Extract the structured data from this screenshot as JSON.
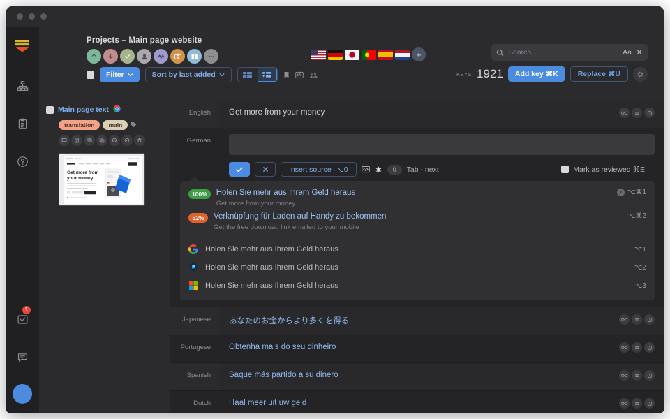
{
  "window": {
    "traffic_lights": 3
  },
  "rail": {
    "items": [
      {
        "name": "logo",
        "icon": "stacked-bars-logo"
      },
      {
        "name": "projects",
        "icon": "sitemap-icon"
      },
      {
        "name": "tasks",
        "icon": "clipboard-icon"
      },
      {
        "name": "help",
        "icon": "question-circle-icon"
      }
    ],
    "bottom": [
      {
        "name": "inbox",
        "icon": "inbox-check-icon",
        "badge": "1"
      },
      {
        "name": "chat",
        "icon": "comment-icon"
      },
      {
        "name": "avatar",
        "icon": "user-avatar"
      }
    ]
  },
  "header": {
    "project_title": "Projects – Main page website",
    "contributors": [
      {
        "icon": "arrow-up-icon",
        "color": "#7fb79b"
      },
      {
        "icon": "arrow-down-icon",
        "color": "#c08d8d"
      },
      {
        "icon": "check-icon",
        "color": "#a7b48d"
      },
      {
        "icon": "person-icon",
        "color": "#a9a9ad"
      },
      {
        "icon": "activity-icon",
        "color": "#9e9acb"
      },
      {
        "icon": "camera-icon",
        "color": "#d3924a"
      },
      {
        "icon": "book-icon",
        "color": "#8fbcd6"
      },
      {
        "icon": "ellipsis-icon",
        "color": "#8d8d92"
      }
    ],
    "flags": [
      {
        "name": "flag-usa",
        "label": "English"
      },
      {
        "name": "flag-germany",
        "label": "German"
      },
      {
        "name": "flag-japan",
        "label": "Japanese"
      },
      {
        "name": "flag-portugal",
        "label": "Portugese"
      },
      {
        "name": "flag-spain",
        "label": "Spanish"
      },
      {
        "name": "flag-netherlands",
        "label": "Dutch"
      }
    ],
    "add_language_label": "+",
    "search": {
      "placeholder": "Search...",
      "value": "",
      "aa_label": "Aa",
      "close_label": "✕"
    },
    "keys_label": "KEYS",
    "keys_count": "1921",
    "add_key_label": "Add key ⌘K",
    "replace_label": "Replace ⌘U",
    "settings_icon": "cpu-chip-icon"
  },
  "toolbar": {
    "select_all_checked": true,
    "filter_label": "Filter",
    "sort_label": "Sort by last added",
    "view_grid_icon": "grid-view-icon",
    "view_list_icon": "list-view-icon",
    "bookmark_icon": "bookmark-icon",
    "code_icon": "code-tag-icon",
    "ab_icon": "ab-compare-icon"
  },
  "key_card": {
    "name": "Main page text",
    "platform_icon": "chrome-icon",
    "tags": [
      {
        "label": "translation",
        "style": "translation"
      },
      {
        "label": "main",
        "style": "main"
      }
    ],
    "tag_more_icon": "tag-icon",
    "actions": [
      {
        "icon": "comment-icon"
      },
      {
        "icon": "description-icon"
      },
      {
        "icon": "screenshot-icon"
      },
      {
        "icon": "copy-icon"
      },
      {
        "icon": "google-translate-icon"
      },
      {
        "icon": "hidden-icon"
      },
      {
        "icon": "trash-icon"
      }
    ],
    "screenshot": {
      "headline_line1": "Get more from",
      "headline_line2": "your money",
      "alt": "landing page screenshot"
    }
  },
  "editor": {
    "source_row": {
      "language": "English",
      "value": "Get more from your money",
      "actions": [
        {
          "icon": "glasses-icon"
        },
        {
          "icon": "translate-icon"
        },
        {
          "icon": "history-icon"
        }
      ]
    },
    "active_row": {
      "language": "German",
      "input_value": "",
      "confirm_icon": "check-icon",
      "cancel_icon": "close-icon",
      "insert_source_label": "Insert source",
      "insert_source_shortcut": "⌥0",
      "code_icon": "code-tag-icon",
      "bug_icon": "bug-icon",
      "char_count": "0",
      "tab_hint": "Tab - next",
      "mark_reviewed_label": "Mark as reviewed ⌘E",
      "mark_reviewed_checked": true
    },
    "suggestions": {
      "memory": [
        {
          "score": "100%",
          "score_style": "green",
          "text": "Holen Sie mehr aus Ihrem Geld heraus",
          "source": "Get more from your money",
          "shortcut": "⌥⌘1",
          "has_remove": true
        },
        {
          "score": "52%",
          "score_style": "orange",
          "text": "Verknüpfung für Laden auf Handy zu bekommen",
          "source": "Get the free download link emailed to your mobile",
          "shortcut": "⌥⌘2",
          "has_remove": false
        }
      ],
      "engines": [
        {
          "engine": "google-translate-icon",
          "text": "Holen Sie mehr aus Ihrem Geld heraus",
          "shortcut": "⌥1"
        },
        {
          "engine": "deepl-icon",
          "text": "Holen Sie mehr aus Ihrem Geld heraus",
          "shortcut": "⌥2"
        },
        {
          "engine": "microsoft-translator-icon",
          "text": "Holen Sie mehr aus Ihrem Geld heraus",
          "shortcut": "⌥3"
        }
      ]
    },
    "other_rows": [
      {
        "language": "Japanese",
        "value": "あなたのお金からより多くを得る",
        "actions": [
          {
            "icon": "glasses-icon"
          },
          {
            "icon": "translate-icon"
          },
          {
            "icon": "history-icon"
          }
        ]
      },
      {
        "language": "Portugese",
        "value": "Obtenha mais do seu dinheiro",
        "actions": [
          {
            "icon": "glasses-icon"
          },
          {
            "icon": "translate-icon"
          },
          {
            "icon": "history-icon"
          }
        ]
      },
      {
        "language": "Spanish",
        "value": "Saque más partido a su dinero",
        "actions": [
          {
            "icon": "glasses-icon"
          },
          {
            "icon": "translate-icon"
          },
          {
            "icon": "history-icon"
          }
        ]
      },
      {
        "language": "Dutch",
        "value": "Haal meer uit uw geld",
        "actions": [
          {
            "icon": "glasses-icon"
          },
          {
            "icon": "translate-icon"
          },
          {
            "icon": "history-icon"
          }
        ]
      }
    ]
  },
  "colors": {
    "accent": "#4b8ce0",
    "window_bg": "#2b2b2e",
    "rail_bg": "#202022",
    "main_bg": "#242426",
    "link": "#8fb8ec",
    "score_good": "#3d9e44",
    "score_mid": "#e0622a",
    "badge_red": "#e8453c"
  }
}
